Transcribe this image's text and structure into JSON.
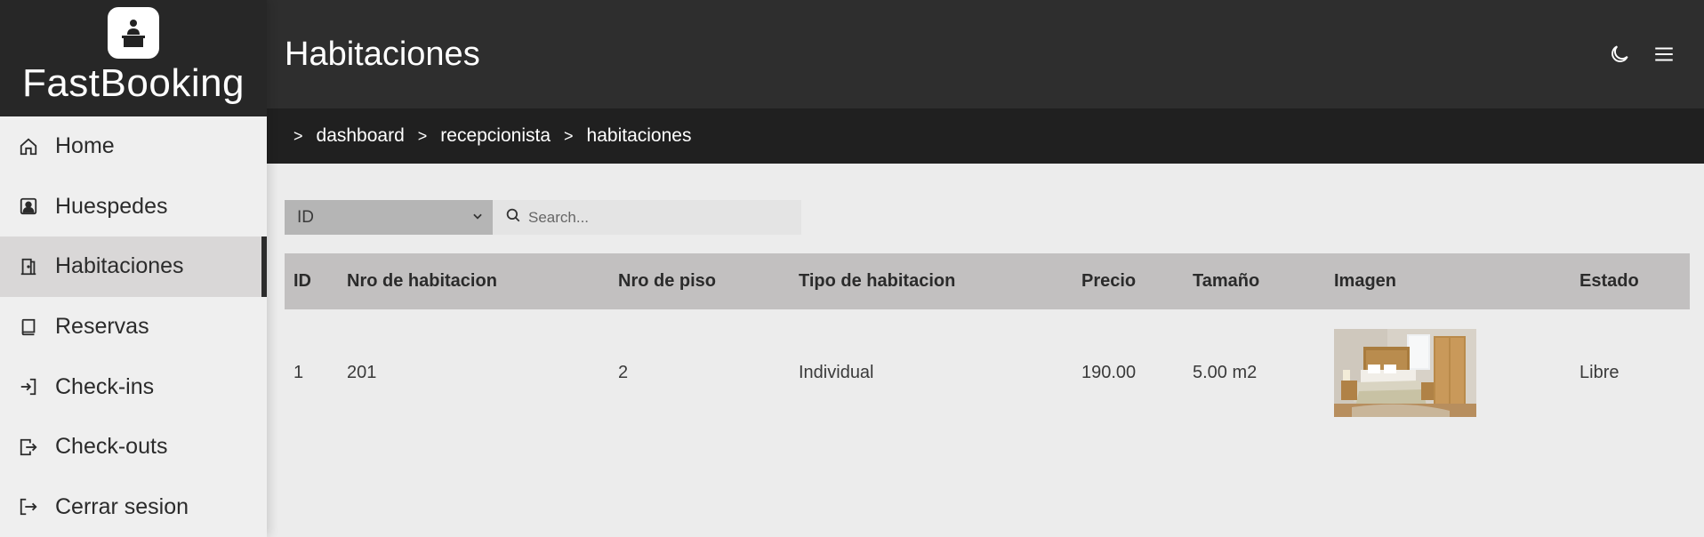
{
  "brand": {
    "name": "FastBooking"
  },
  "sidebar": {
    "items": [
      {
        "label": "Home",
        "icon": "home-icon",
        "active": false
      },
      {
        "label": "Huespedes",
        "icon": "user-square-icon",
        "active": false
      },
      {
        "label": "Habitaciones",
        "icon": "door-icon",
        "active": true
      },
      {
        "label": "Reservas",
        "icon": "book-icon",
        "active": false
      },
      {
        "label": "Check-ins",
        "icon": "login-icon",
        "active": false
      },
      {
        "label": "Check-outs",
        "icon": "logout-box-icon",
        "active": false
      },
      {
        "label": "Cerrar sesion",
        "icon": "logout-icon",
        "active": false
      }
    ]
  },
  "header": {
    "title": "Habitaciones",
    "actions": [
      "moon-icon",
      "menu-icon"
    ]
  },
  "breadcrumb": [
    "dashboard",
    "recepcionista",
    "habitaciones"
  ],
  "filter": {
    "select_value": "ID",
    "search_placeholder": "Search..."
  },
  "table": {
    "columns": [
      "ID",
      "Nro de habitacion",
      "Nro de piso",
      "Tipo de habitacion",
      "Precio",
      "Tamaño",
      "Imagen",
      "Estado"
    ],
    "rows": [
      {
        "id": "1",
        "nro_habitacion": "201",
        "nro_piso": "2",
        "tipo": "Individual",
        "precio": "190.00",
        "tamano": "5.00 m2",
        "imagen": "bedroom-photo",
        "estado": "Libre"
      }
    ]
  },
  "colors": {
    "topbar": "#2e2e2e",
    "breadcrumb": "#202020",
    "sidebar": "#efefef",
    "active": "#d9d7d7",
    "table_header": "#c2c0c0"
  }
}
